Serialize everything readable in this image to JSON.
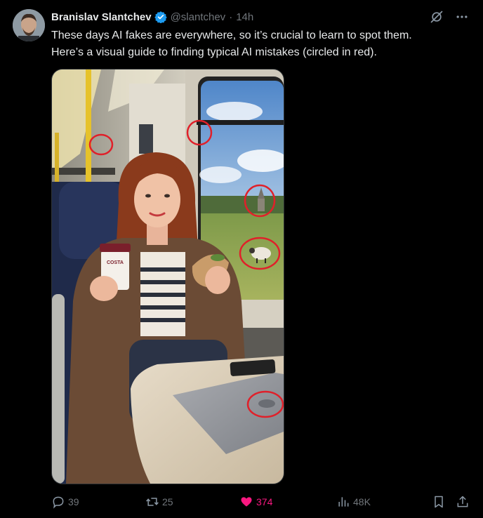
{
  "author": {
    "display_name": "Branislav Slantchev",
    "handle": "@slantchev",
    "time": "14h"
  },
  "tweet": {
    "lines": [
      "These days AI fakes are everywhere, so it’s crucial to learn to spot them.",
      "Here’s a visual guide to finding typical AI mistakes (circled in red)."
    ]
  },
  "media": {
    "cup_text": "COSTA"
  },
  "metrics": {
    "replies": "39",
    "reposts": "25",
    "likes": "374",
    "views": "48K"
  },
  "colors": {
    "background": "#000000",
    "text": "#e7e9ea",
    "muted": "#71767b",
    "verified": "#1d9bf0",
    "like": "#f91880",
    "annotation": "#e0202a"
  },
  "icons": {
    "verified": "verified-badge-icon",
    "grok": "grok-icon",
    "more": "more-icon",
    "reply": "reply-icon",
    "repost": "repost-icon",
    "like": "heart-icon",
    "views": "views-icon",
    "bookmark": "bookmark-icon",
    "share": "share-icon"
  }
}
